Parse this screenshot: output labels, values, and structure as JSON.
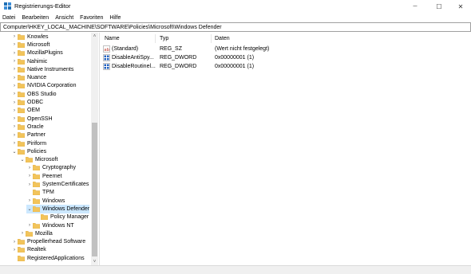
{
  "window": {
    "title": "Registrierungs-Editor",
    "controls": {
      "minimize": "─",
      "maximize": "☐",
      "close": "✕"
    }
  },
  "menu": [
    "Datei",
    "Bearbeiten",
    "Ansicht",
    "Favoriten",
    "Hilfe"
  ],
  "address": "Computer\\HKEY_LOCAL_MACHINE\\SOFTWARE\\Policies\\Microsoft\\Windows Defender",
  "tree": [
    {
      "label": "Knowles",
      "chevron": "›",
      "level": 2
    },
    {
      "label": "Microsoft",
      "chevron": "›",
      "level": 2
    },
    {
      "label": "MozillaPlugins",
      "chevron": "›",
      "level": 2
    },
    {
      "label": "Nahimic",
      "chevron": "›",
      "level": 2
    },
    {
      "label": "Native Instruments",
      "chevron": "›",
      "level": 2
    },
    {
      "label": "Nuance",
      "chevron": "›",
      "level": 2
    },
    {
      "label": "NVIDIA Corporation",
      "chevron": "›",
      "level": 2
    },
    {
      "label": "OBS Studio",
      "chevron": "›",
      "level": 2
    },
    {
      "label": "ODBC",
      "chevron": "›",
      "level": 2
    },
    {
      "label": "OEM",
      "chevron": "›",
      "level": 2
    },
    {
      "label": "OpenSSH",
      "chevron": "›",
      "level": 2
    },
    {
      "label": "Oracle",
      "chevron": "›",
      "level": 2
    },
    {
      "label": "Partner",
      "chevron": "›",
      "level": 2
    },
    {
      "label": "Piriform",
      "chevron": "›",
      "level": 2
    },
    {
      "label": "Policies",
      "chevron": "⌄",
      "level": 2
    },
    {
      "label": "Microsoft",
      "chevron": "⌄",
      "level": 3
    },
    {
      "label": "Cryptography",
      "chevron": "›",
      "level": 4
    },
    {
      "label": "Peernet",
      "chevron": "›",
      "level": 4
    },
    {
      "label": "SystemCertificates",
      "chevron": "›",
      "level": 4
    },
    {
      "label": "TPM",
      "chevron": "",
      "level": 4
    },
    {
      "label": "Windows",
      "chevron": "›",
      "level": 4
    },
    {
      "label": "Windows Defender",
      "chevron": "⌄",
      "level": 4,
      "selected": true
    },
    {
      "label": "Policy Manager",
      "chevron": "",
      "level": 5
    },
    {
      "label": "Windows NT",
      "chevron": "›",
      "level": 4
    },
    {
      "label": "Mozilla",
      "chevron": "›",
      "level": 3
    },
    {
      "label": "Propellerhead Software",
      "chevron": "›",
      "level": 2
    },
    {
      "label": "Realtek",
      "chevron": "›",
      "level": 2
    },
    {
      "label": "RegisteredApplications",
      "chevron": "",
      "level": 2
    }
  ],
  "scroll_arrows": {
    "up": "˄",
    "down": "˅"
  },
  "columns": {
    "name": "Name",
    "type": "Typ",
    "data": "Daten"
  },
  "values": [
    {
      "name": "(Standard)",
      "type": "REG_SZ",
      "data": "(Wert nicht festgelegt)",
      "icon": "string-value-icon"
    },
    {
      "name": "DisableAntiSpy...",
      "type": "REG_DWORD",
      "data": "0x00000001 (1)",
      "icon": "binary-value-icon"
    },
    {
      "name": "DisableRoutinel...",
      "type": "REG_DWORD",
      "data": "0x00000001 (1)",
      "icon": "binary-value-icon"
    }
  ],
  "colors": {
    "folder": "#f2c45b",
    "folder_dark": "#dba43a",
    "selection": "#cce8ff",
    "accent": "#0078d7"
  }
}
